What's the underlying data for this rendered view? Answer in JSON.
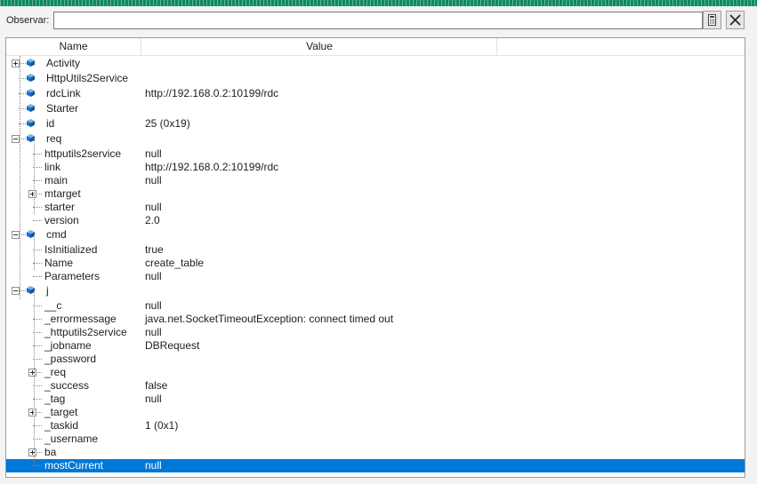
{
  "watch": {
    "label": "Observar:",
    "input_value": "",
    "calc_icon": "calculator-icon",
    "close_icon": "close-icon"
  },
  "columns": {
    "name": "Name",
    "value": "Value"
  },
  "colors": {
    "title_strip": "#0e8a62",
    "selection": "#0078d7",
    "object_icon": "#1e6fc4"
  },
  "rows": [
    {
      "name": "Activity",
      "value": "",
      "expander": "plus",
      "icon": "object-cube-icon"
    },
    {
      "name": "HttpUtils2Service",
      "value": "",
      "expander": "",
      "icon": "object-cube-icon"
    },
    {
      "name": "rdcLink",
      "value": "http://192.168.0.2:10199/rdc",
      "expander": "",
      "icon": "object-cube-icon"
    },
    {
      "name": "Starter",
      "value": "",
      "expander": "",
      "icon": "object-cube-icon"
    },
    {
      "name": "id",
      "value": "25 (0x19)",
      "expander": "",
      "icon": "object-cube-icon"
    },
    {
      "name": "req",
      "value": "",
      "expander": "minus",
      "icon": "object-cube-icon"
    },
    {
      "name": "httputils2service",
      "value": "null",
      "expander": "",
      "icon": ""
    },
    {
      "name": "link",
      "value": "http://192.168.0.2:10199/rdc",
      "expander": "",
      "icon": ""
    },
    {
      "name": "main",
      "value": "null",
      "expander": "",
      "icon": ""
    },
    {
      "name": "mtarget",
      "value": "",
      "expander": "plus",
      "icon": ""
    },
    {
      "name": "starter",
      "value": "null",
      "expander": "",
      "icon": ""
    },
    {
      "name": "version",
      "value": "2.0",
      "expander": "",
      "icon": ""
    },
    {
      "name": "cmd",
      "value": "",
      "expander": "minus",
      "icon": "object-cube-icon"
    },
    {
      "name": "IsInitialized",
      "value": "true",
      "expander": "",
      "icon": ""
    },
    {
      "name": "Name",
      "value": "create_table",
      "expander": "",
      "icon": ""
    },
    {
      "name": "Parameters",
      "value": "null",
      "expander": "",
      "icon": ""
    },
    {
      "name": "j",
      "value": "",
      "expander": "minus",
      "icon": "object-cube-icon"
    },
    {
      "name": "__c",
      "value": "null",
      "expander": "",
      "icon": ""
    },
    {
      "name": "_errormessage",
      "value": "java.net.SocketTimeoutException: connect timed out",
      "expander": "",
      "icon": ""
    },
    {
      "name": "_httputils2service",
      "value": "null",
      "expander": "",
      "icon": ""
    },
    {
      "name": "_jobname",
      "value": "DBRequest",
      "expander": "",
      "icon": ""
    },
    {
      "name": "_password",
      "value": "",
      "expander": "",
      "icon": ""
    },
    {
      "name": "_req",
      "value": "",
      "expander": "plus",
      "icon": ""
    },
    {
      "name": "_success",
      "value": "false",
      "expander": "",
      "icon": ""
    },
    {
      "name": "_tag",
      "value": "null",
      "expander": "",
      "icon": ""
    },
    {
      "name": "_target",
      "value": "",
      "expander": "plus",
      "icon": ""
    },
    {
      "name": "_taskid",
      "value": "1 (0x1)",
      "expander": "",
      "icon": ""
    },
    {
      "name": "_username",
      "value": "",
      "expander": "",
      "icon": ""
    },
    {
      "name": "ba",
      "value": "",
      "expander": "plus",
      "icon": ""
    },
    {
      "name": "mostCurrent",
      "value": "null",
      "expander": "",
      "icon": "",
      "selected": true
    }
  ]
}
